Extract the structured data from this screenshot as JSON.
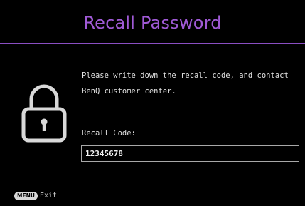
{
  "dialog": {
    "title": "Recall Password",
    "message": "Please write down the recall code, and contact BenQ customer center.",
    "code_label": "Recall Code:",
    "code_value": "12345678",
    "icon": "lock-icon"
  },
  "footer": {
    "menu_key": "MENU",
    "exit_label": "Exit"
  },
  "colors": {
    "title": "#a05ad6",
    "divider": "#8a4ec2",
    "background": "#000000"
  }
}
